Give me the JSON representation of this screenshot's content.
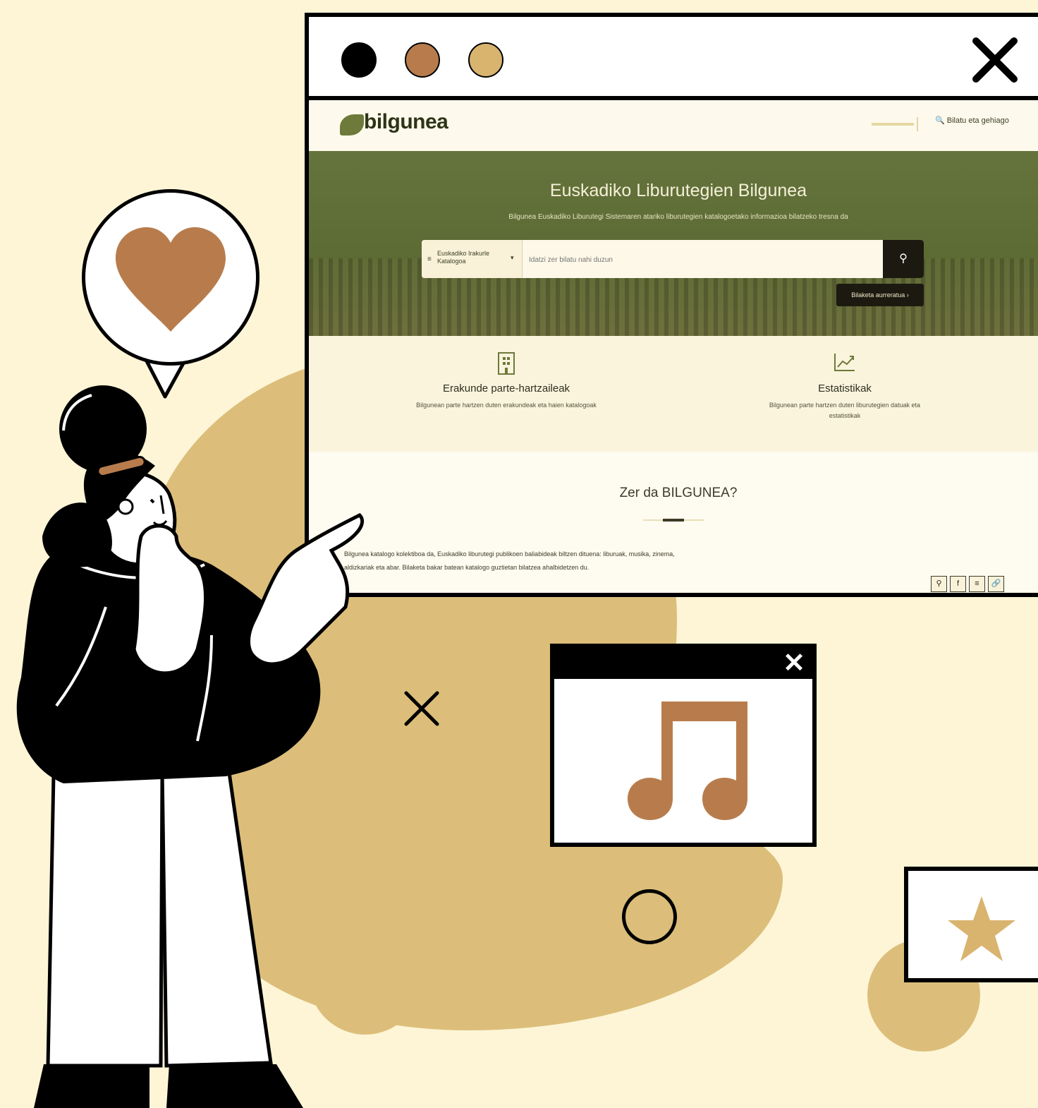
{
  "colors": {
    "background": "#fdf5d6",
    "blob": "#dcbe7a",
    "accent_brown": "#b87c4c",
    "accent_sand": "#d9b46f",
    "hero_green": "#65733c"
  },
  "browser": {
    "window_dots": [
      "black",
      "brown",
      "sand"
    ],
    "close_icon": "close-icon"
  },
  "site": {
    "logo": "bilgunea",
    "header_search_label": "Bilatu eta gehiago",
    "hero": {
      "title": "Euskadiko Liburutegien Bilgunea",
      "subtitle": "Bilgunea Euskadiko Liburutegi Sistemaren atariko liburutegien katalogoetako informazioa bilatzeko tresna da",
      "select_label": "Euskadiko Irakurle Katalogoa",
      "search_placeholder": "Idatzi zer bilatu nahi duzun",
      "advanced_search": "Bilaketa aurreratua"
    },
    "features": [
      {
        "icon": "building-icon",
        "title": "Erakunde parte-hartzaileak",
        "desc": "Bilgunean parte hartzen duten erakundeak eta haien katalogoak"
      },
      {
        "icon": "chart-icon",
        "title": "Estatistikak",
        "desc": "Bilgunean parte hartzen duten liburutegien datuak eta estatistikak"
      }
    ],
    "about": {
      "title": "Zer da BILGUNEA?",
      "text": "Bilgunea katalogo kolektiboa da, Euskadiko liburutegi publikoen baliabideak biltzen dituena: liburuak, musika, zinema, aldizkariak eta abar. Bilaketa bakar batean katalogo guztietan bilatzea ahalbidetzen du."
    },
    "share_icons": [
      "search-icon",
      "facebook-icon",
      "menu-icon",
      "link-icon"
    ]
  },
  "illustration": {
    "bubble_icon": "heart-icon",
    "music_icon": "music-note-icon",
    "star_icon": "star-icon"
  }
}
